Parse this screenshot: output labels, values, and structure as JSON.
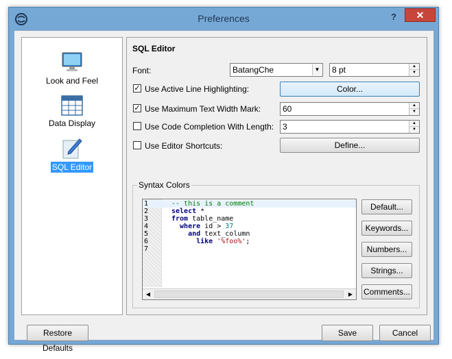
{
  "window": {
    "title": "Preferences",
    "help": "?",
    "close": "✕"
  },
  "sidebar": {
    "items": [
      {
        "label": "Look and Feel",
        "icon": "monitor-icon"
      },
      {
        "label": "Data Display",
        "icon": "table-icon"
      },
      {
        "label": "SQL Editor",
        "icon": "pen-icon",
        "selected": true
      }
    ]
  },
  "sql_editor": {
    "title": "SQL Editor",
    "font_label": "Font:",
    "font_value": "BatangChe",
    "font_size": "8 pt",
    "active_line_label": "Use Active Line Highlighting:",
    "active_line_checked": true,
    "color_button": "Color...",
    "max_width_label": "Use Maximum Text Width Mark:",
    "max_width_checked": true,
    "max_width_value": "60",
    "completion_label": "Use Code Completion With Length:",
    "completion_checked": false,
    "completion_value": "3",
    "shortcuts_label": "Use Editor Shortcuts:",
    "shortcuts_checked": false,
    "define_button": "Define..."
  },
  "syntax": {
    "title": "Syntax Colors",
    "lines": [
      {
        "n": "1",
        "tokens": [
          {
            "t": "-- this is a comment",
            "c": "cm"
          }
        ]
      },
      {
        "n": "2",
        "tokens": [
          {
            "t": "select",
            "c": "kw"
          },
          {
            "t": " *",
            "c": ""
          }
        ]
      },
      {
        "n": "3",
        "tokens": [
          {
            "t": "from",
            "c": "kw"
          },
          {
            "t": " table_name",
            "c": ""
          }
        ]
      },
      {
        "n": "4",
        "tokens": [
          {
            "t": "  where",
            "c": "kw"
          },
          {
            "t": " id > ",
            "c": ""
          },
          {
            "t": "37",
            "c": "nm"
          }
        ]
      },
      {
        "n": "5",
        "tokens": [
          {
            "t": "    and",
            "c": "kw"
          },
          {
            "t": " text_column",
            "c": ""
          }
        ]
      },
      {
        "n": "6",
        "tokens": [
          {
            "t": "      like",
            "c": "kw"
          },
          {
            "t": " ",
            "c": ""
          },
          {
            "t": "'%foo%'",
            "c": "st"
          },
          {
            "t": ";",
            "c": ""
          }
        ]
      },
      {
        "n": "7",
        "tokens": []
      }
    ],
    "buttons": {
      "default": "Default...",
      "keywords": "Keywords...",
      "numbers": "Numbers...",
      "strings": "Strings...",
      "comments": "Comments..."
    }
  },
  "footer": {
    "restore": "Restore Defaults",
    "save": "Save",
    "cancel": "Cancel"
  },
  "colors": {
    "titlebar": "#76a8d6",
    "close": "#c7463c",
    "selection": "#3399ff"
  }
}
